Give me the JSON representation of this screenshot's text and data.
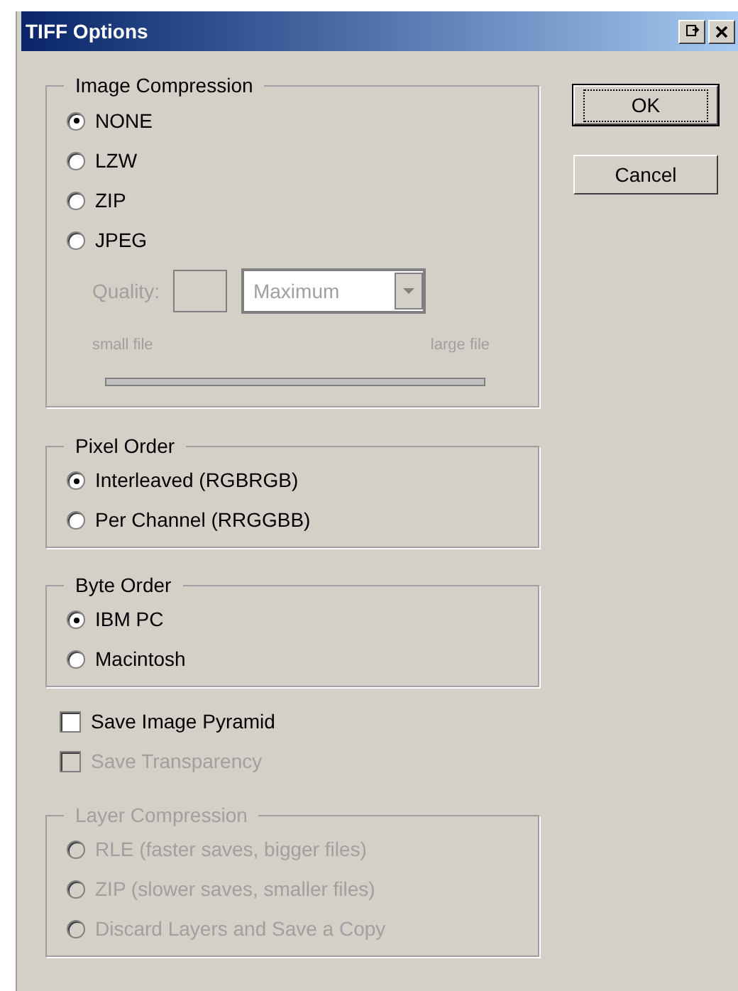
{
  "window": {
    "title": "TIFF Options"
  },
  "image_compression": {
    "title": "Image Compression",
    "options": [
      {
        "label": "NONE",
        "selected": true
      },
      {
        "label": "LZW",
        "selected": false
      },
      {
        "label": "ZIP",
        "selected": false
      },
      {
        "label": "JPEG",
        "selected": false
      }
    ],
    "quality": {
      "label": "Quality:",
      "value": "Maximum",
      "disabled": true
    },
    "size_slider": {
      "min_label": "small file",
      "max_label": "large file",
      "disabled": true
    }
  },
  "pixel_order": {
    "title": "Pixel Order",
    "disabled": false,
    "options": [
      {
        "label": "Interleaved (RGBRGB)",
        "selected": true
      },
      {
        "label": "Per Channel (RRGGBB)",
        "selected": false
      }
    ]
  },
  "byte_order": {
    "title": "Byte Order",
    "disabled": false,
    "options": [
      {
        "label": "IBM PC",
        "selected": true
      },
      {
        "label": "Macintosh",
        "selected": false
      }
    ]
  },
  "checkboxes": [
    {
      "label": "Save Image Pyramid",
      "checked": false,
      "disabled": false
    },
    {
      "label": "Save Transparency",
      "checked": false,
      "disabled": true
    }
  ],
  "layer_compression": {
    "title": "Layer Compression",
    "disabled": true,
    "options": [
      {
        "label": "RLE (faster saves, bigger files)",
        "selected": false
      },
      {
        "label": "ZIP (slower saves, smaller files)",
        "selected": false
      },
      {
        "label": "Discard Layers and Save a Copy",
        "selected": false
      }
    ]
  },
  "buttons": [
    {
      "label": "OK",
      "default": true
    },
    {
      "label": "Cancel",
      "default": false
    }
  ]
}
